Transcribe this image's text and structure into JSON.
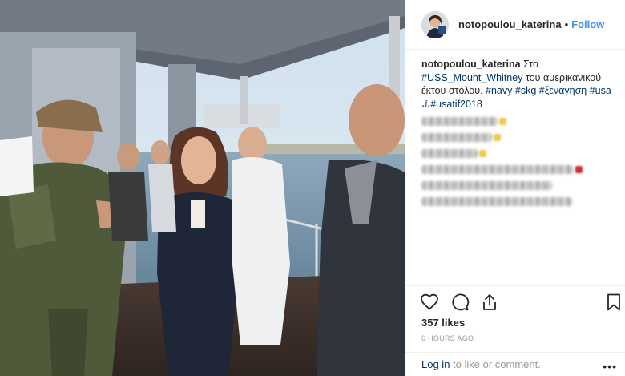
{
  "header": {
    "username": "notopoulou_katerina",
    "separator": "•",
    "follow_label": "Follow"
  },
  "caption": {
    "username": "notopoulou_katerina",
    "text_start": "Στο",
    "tag_ship": "#USS_Mount_Whitney",
    "text_mid": "του αμερικανικού έκτου στόλου.",
    "tag_navy": "#navy",
    "tag_skg": "#skg",
    "tag_tour": "#ξεναγηση",
    "tag_usa": "#usa",
    "anchor_symbol": "⚓",
    "tag_usatif": "#usatif2018"
  },
  "comments_blurred": [
    {
      "width": 95,
      "emoji_color": "#f2c94c"
    },
    {
      "width": 88,
      "emoji_color": "#f2c94c"
    },
    {
      "width": 70,
      "emoji_color": "#f2c94c"
    },
    {
      "width": 190,
      "emoji_color": "#d0293a"
    },
    {
      "width": 163,
      "emoji_color": ""
    },
    {
      "width": 188,
      "emoji_color": ""
    }
  ],
  "actions": {
    "like_icon": "heart-icon",
    "comment_icon": "comment-icon",
    "share_icon": "share-icon",
    "save_icon": "bookmark-icon"
  },
  "likes_text": "357 likes",
  "timestamp": "6 HOURS AGO",
  "comment_bar": {
    "login_label": "Log in",
    "rest_text": "to like or comment."
  },
  "more_label": "•••",
  "colors": {
    "link_blue": "#3897f0",
    "hashtag": "#003569",
    "muted": "#999999"
  }
}
